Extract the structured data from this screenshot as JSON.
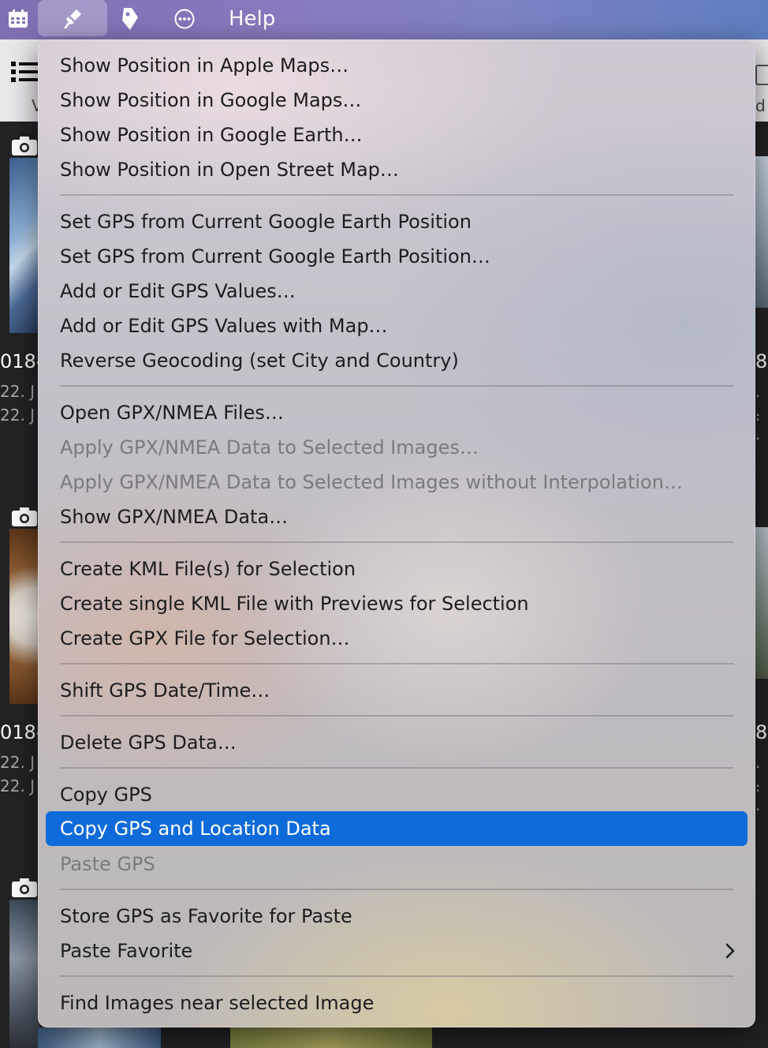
{
  "menubar": {
    "icons": [
      "calendar-icon",
      "pin-gps-icon",
      "tag-icon",
      "more-ellipsis-icon"
    ],
    "help_label": "Help"
  },
  "background": {
    "cells": [
      {
        "name": "018-",
        "date1": "22. J",
        "date2": "22. J"
      },
      {
        "name": "018-",
        "date1": "22. J",
        "date2": "22. J"
      }
    ],
    "right": [
      {
        "name": "8",
        "date1": ". .",
        "date2": ". ."
      },
      {
        "name": "8",
        "date1": ". .",
        "date2": ". ."
      }
    ],
    "toolbar_left": "V",
    "toolbar_right": "d"
  },
  "menu": {
    "items": [
      {
        "label": "Show Position in Apple Maps…",
        "enabled": true
      },
      {
        "label": "Show Position in Google Maps…",
        "enabled": true
      },
      {
        "label": "Show Position in Google Earth…",
        "enabled": true
      },
      {
        "label": "Show Position in Open Street Map…",
        "enabled": true
      },
      {
        "label": "Set GPS from Current Google Earth Position",
        "enabled": true
      },
      {
        "label": "Set GPS from Current Google Earth Position…",
        "enabled": true
      },
      {
        "label": "Add or Edit GPS Values…",
        "enabled": true
      },
      {
        "label": "Add or Edit GPS Values with Map…",
        "enabled": true
      },
      {
        "label": "Reverse Geocoding (set City and Country)",
        "enabled": true
      },
      {
        "label": "Open GPX/NMEA Files…",
        "enabled": true
      },
      {
        "label": "Apply GPX/NMEA Data to Selected Images…",
        "enabled": false
      },
      {
        "label": "Apply GPX/NMEA Data to Selected Images without Interpolation…",
        "enabled": false
      },
      {
        "label": "Show GPX/NMEA Data…",
        "enabled": true
      },
      {
        "label": "Create KML File(s) for Selection",
        "enabled": true
      },
      {
        "label": "Create single KML File with Previews for Selection",
        "enabled": true
      },
      {
        "label": "Create GPX File for Selection…",
        "enabled": true
      },
      {
        "label": "Shift GPS Date/Time…",
        "enabled": true
      },
      {
        "label": "Delete GPS Data…",
        "enabled": true
      },
      {
        "label": "Copy GPS",
        "enabled": true
      },
      {
        "label": "Copy GPS and Location Data",
        "enabled": true,
        "highlighted": true
      },
      {
        "label": "Paste GPS",
        "enabled": false
      },
      {
        "label": "Store GPS as Favorite for Paste",
        "enabled": true
      },
      {
        "label": "Paste Favorite",
        "enabled": true,
        "submenu": true
      },
      {
        "label": "Find Images near selected Image",
        "enabled": true
      }
    ]
  },
  "colors": {
    "highlight": "#0f6bd9",
    "menubar_start": "#7f6fb2",
    "menubar_end": "#5f7ec0",
    "disabled_text": "#7a7a7e"
  }
}
